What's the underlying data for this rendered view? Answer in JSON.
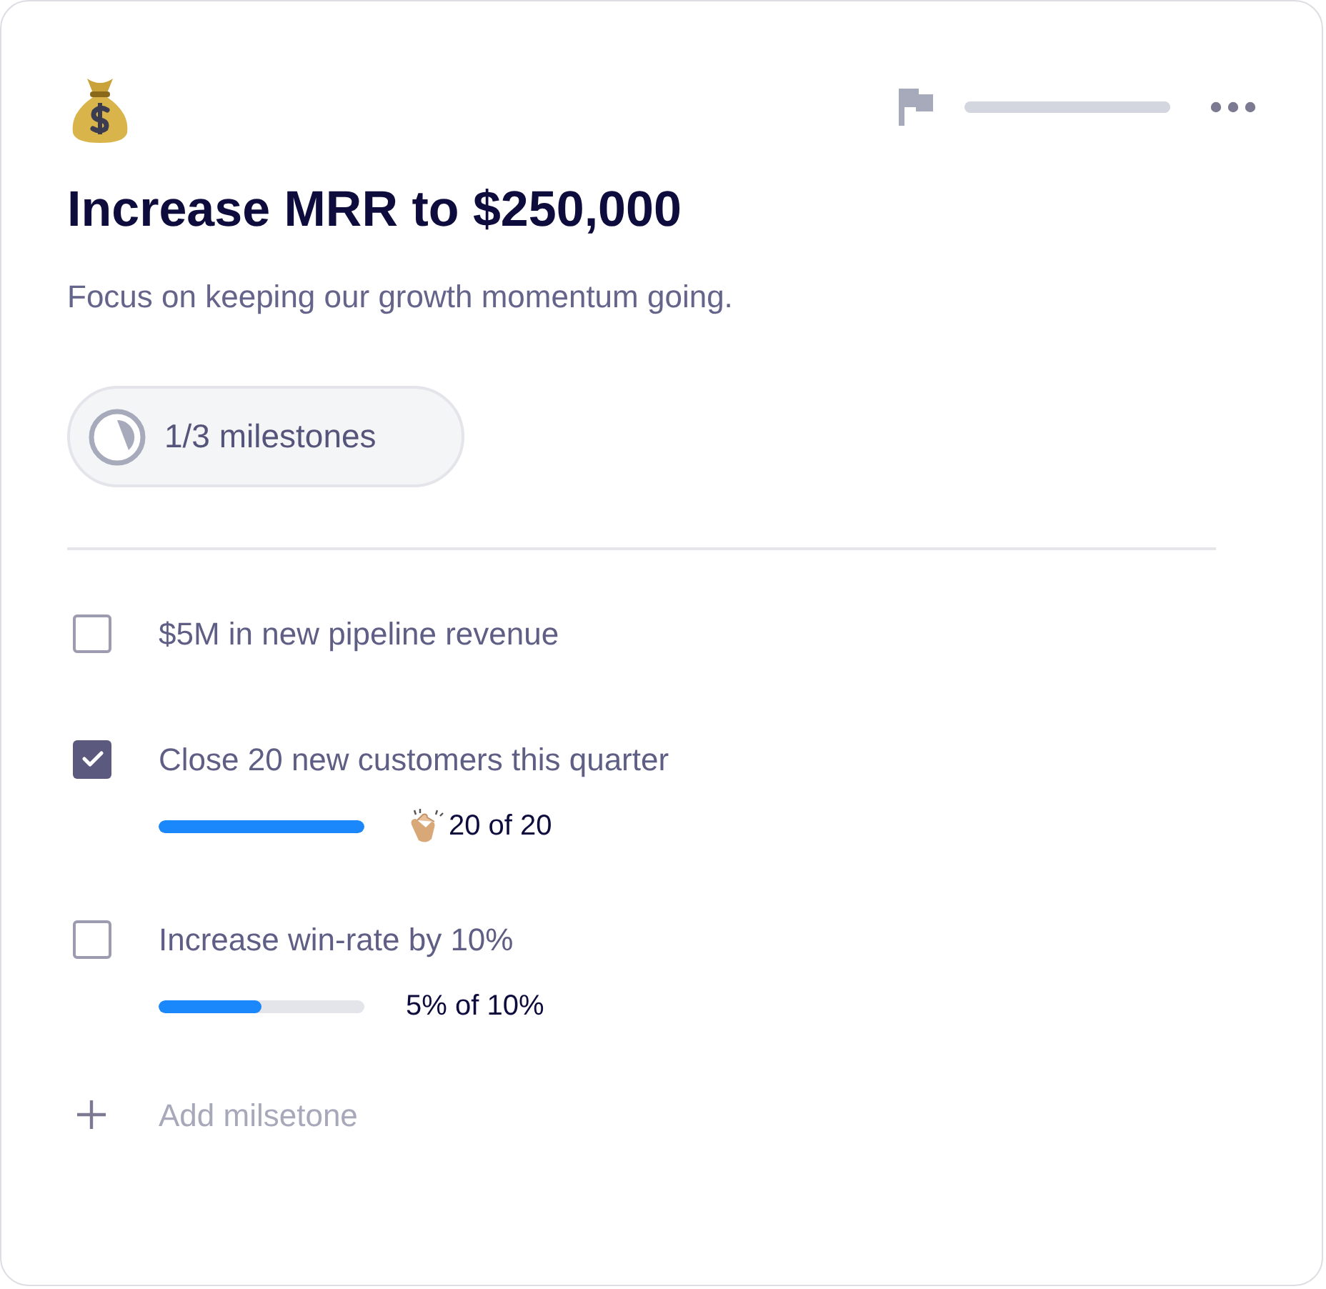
{
  "goal": {
    "title": "Increase MRR to $250,000",
    "description": "Focus on keeping our growth momentum going.",
    "milestone_count": "1/3 milestones"
  },
  "milestones": [
    {
      "text": "$5M in new pipeline revenue",
      "checked": false
    },
    {
      "text": "Close 20 new customers this quarter",
      "checked": true,
      "level": 1,
      "progress": "20 of 20",
      "celebrate": true
    },
    {
      "text": "Increase win-rate by 10%",
      "checked": false,
      "level": 0.5,
      "progress": "5% of 10%",
      "celebrate": false
    }
  ],
  "add_milestone": {
    "placeholder": "Add milsetone"
  }
}
